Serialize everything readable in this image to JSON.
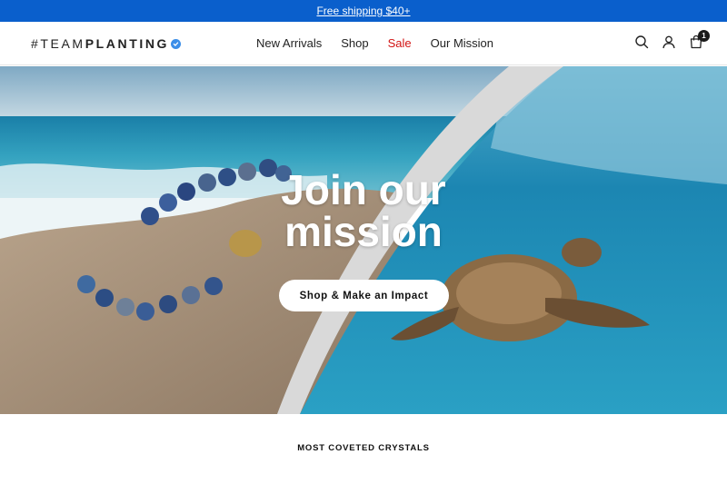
{
  "announcement": {
    "text": "Free shipping $40+"
  },
  "logo": {
    "part_thin": "#TEAM",
    "part_bold": "PLANTING",
    "badge": "verified-badge-icon"
  },
  "nav": {
    "items": [
      {
        "label": "New Arrivals"
      },
      {
        "label": "Shop"
      },
      {
        "label": "Sale"
      },
      {
        "label": "Our Mission"
      }
    ]
  },
  "header_icons": {
    "search": "search-icon",
    "account": "user-icon",
    "cart": "cart-icon",
    "cart_count": "1"
  },
  "hero": {
    "title_line1": "Join our",
    "title_line2": "mission",
    "cta_label": "Shop & Make an Impact"
  },
  "section": {
    "title": "MOST COVETED CRYSTALS"
  },
  "colors": {
    "announcement_bg": "#0a5fcc",
    "sale": "#d21414",
    "text": "#222222"
  }
}
